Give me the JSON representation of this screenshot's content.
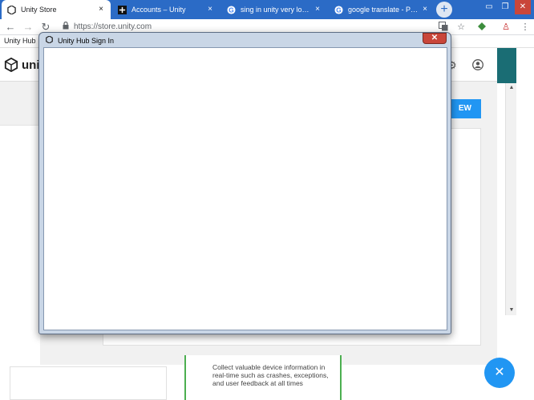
{
  "browser": {
    "tabs": [
      {
        "label": "Unity Store",
        "active": true,
        "icon": "unity-icon"
      },
      {
        "label": "Accounts – Unity",
        "active": false,
        "icon": "unity-plus-icon"
      },
      {
        "label": "sing in unity very long - P",
        "active": false,
        "icon": "google-icon"
      },
      {
        "label": "google translate - Penelu",
        "active": false,
        "icon": "google-icon"
      }
    ],
    "tab_close": "×",
    "new_tab": "+",
    "window_controls": {
      "minimize": "▭",
      "restore": "❐",
      "close": "✕"
    },
    "nav": {
      "back": "←",
      "forward": "→",
      "reload": "↻"
    },
    "url": "https://store.unity.com",
    "bookmark": "Unity Hub"
  },
  "page": {
    "logo_text": "unity",
    "view_button": "EW",
    "bottom_text": "Collect valuable device information in real-time such as crashes, exceptions, and user feedback at all times",
    "fab": "✕"
  },
  "dialog": {
    "title": "Unity Hub Sign In",
    "close": "✕"
  },
  "colors": {
    "chrome_blue": "#2b6bc6",
    "accent_blue": "#2196f3",
    "teal": "#1a6d74",
    "dialog_frame": "#c9d6e6",
    "close_red": "#c9463a"
  }
}
